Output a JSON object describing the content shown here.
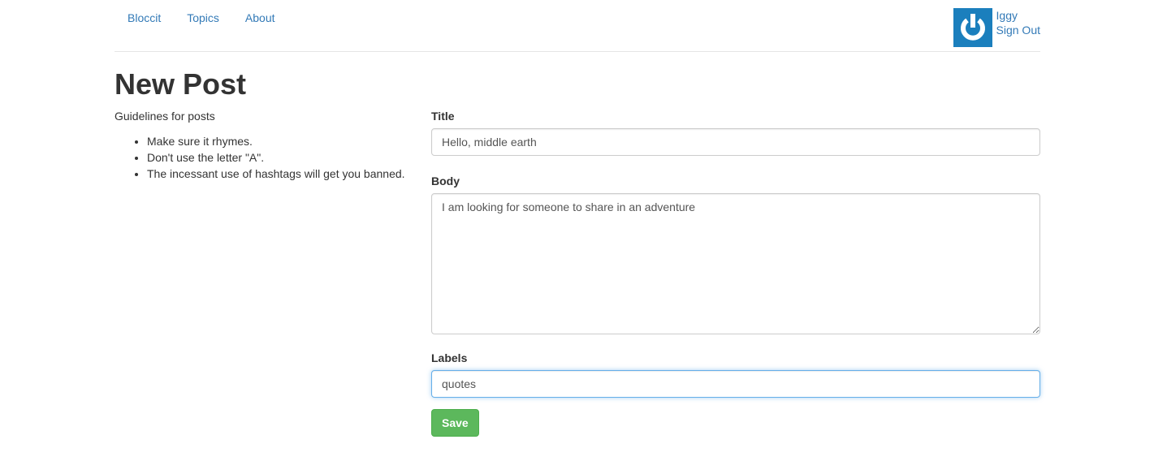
{
  "nav": {
    "links": [
      "Bloccit",
      "Topics",
      "About"
    ]
  },
  "user": {
    "name": "Iggy",
    "sign_out": "Sign Out",
    "avatar_color": "#1b7fbd",
    "avatar_icon": "power-icon"
  },
  "page": {
    "title": "New Post"
  },
  "guidelines": {
    "heading": "Guidelines for posts",
    "items": [
      "Make sure it rhymes.",
      "Don't use the letter \"A\".",
      "The incessant use of hashtags will get you banned."
    ]
  },
  "form": {
    "title_label": "Title",
    "title_value": "Hello, middle earth",
    "body_label": "Body",
    "body_value": "I am looking for someone to share in an adventure",
    "labels_label": "Labels",
    "labels_value": "quotes",
    "save_label": "Save",
    "save_color": "#5cb85c"
  },
  "colors": {
    "link": "#337ab7",
    "focus_border": "#66afe9"
  }
}
